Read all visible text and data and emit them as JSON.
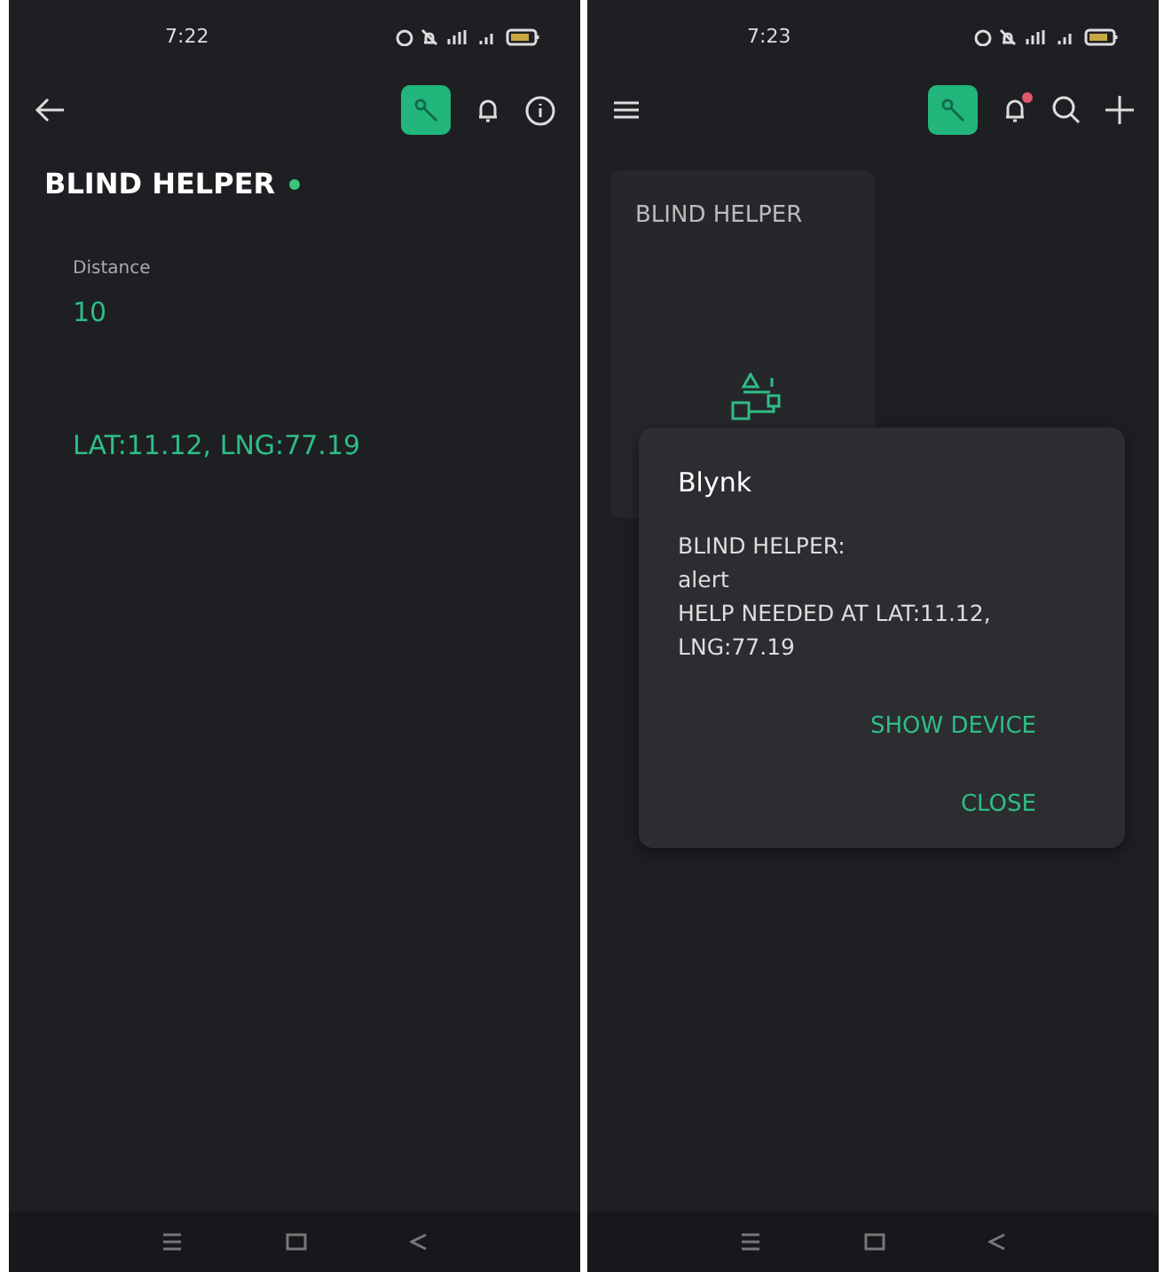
{
  "screens": [
    {
      "kind": "device",
      "status_bar": {
        "time": "7:22"
      },
      "toolbar": {
        "has_unread": false
      },
      "device": {
        "title": "BLIND HELPER",
        "online": true
      },
      "widgets": [
        {
          "kind": "value",
          "label": "Distance",
          "value": "10"
        },
        {
          "kind": "text",
          "value": "LAT:11.12, LNG:77.19"
        }
      ]
    },
    {
      "kind": "home",
      "status_bar": {
        "time": "7:23"
      },
      "toolbar": {
        "has_unread": true
      },
      "tile": {
        "title": "BLIND HELPER"
      },
      "dialog": {
        "title": "Blynk",
        "message": "BLIND HELPER:\nalert\nHELP NEEDED AT LAT:11.12,\nLNG:77.19",
        "actions": [
          "SHOW DEVICE",
          "CLOSE"
        ]
      }
    }
  ]
}
